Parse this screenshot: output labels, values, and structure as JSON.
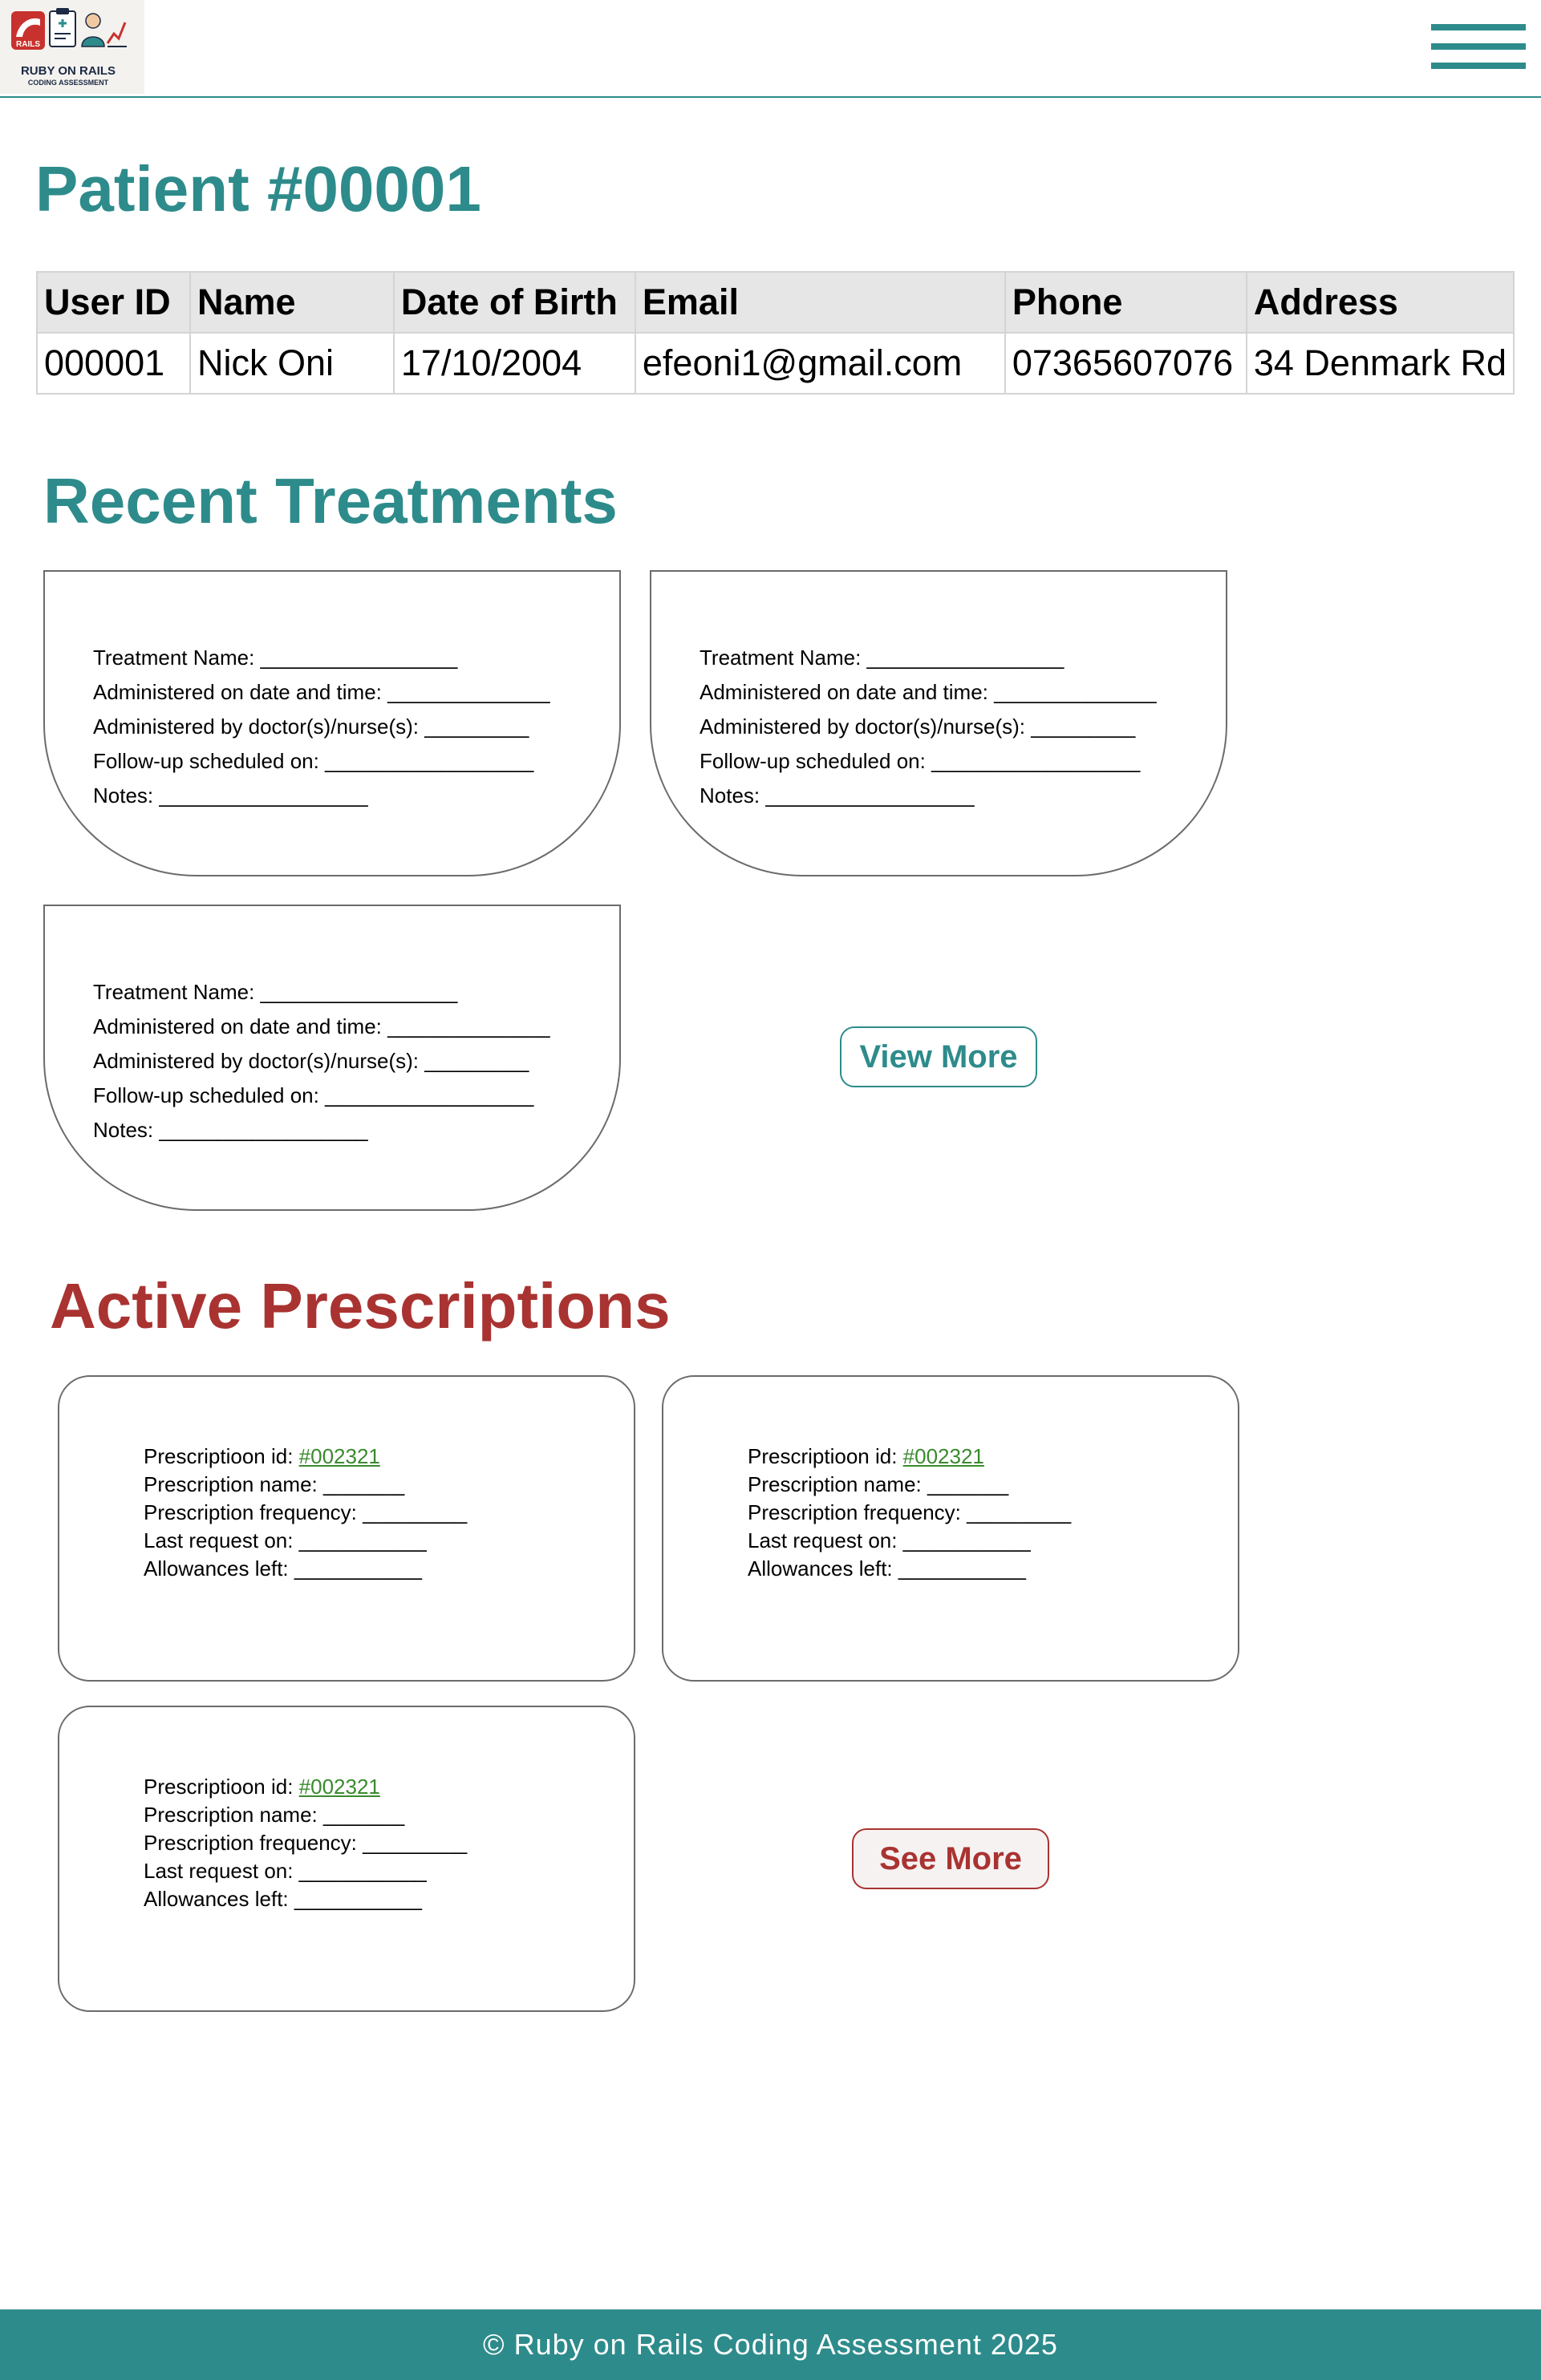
{
  "header": {
    "logo": {
      "badge": "RAILS",
      "title": "RUBY ON RAILS",
      "subtitle": "CODING ASSESSMENT"
    },
    "menu_icon": "hamburger-icon"
  },
  "patient": {
    "title": "Patient #00001",
    "columns": [
      "User ID",
      "Name",
      "Date of Birth",
      "Email",
      "Phone",
      "Address"
    ],
    "row": [
      "000001",
      "Nick Oni",
      "17/10/2004",
      "efeoni1@gmail.com",
      "07365607076",
      "34 Denmark Rd"
    ]
  },
  "treatments": {
    "title": "Recent Treatments",
    "cards": [
      {
        "lines": [
          "Treatment Name: _________________",
          "Administered on date and time: ______________",
          "Administered by doctor(s)/nurse(s): _________",
          "Follow-up scheduled on: __________________",
          "Notes: __________________"
        ]
      },
      {
        "lines": [
          "Treatment Name: _________________",
          "Administered on date and time: ______________",
          "Administered by doctor(s)/nurse(s): _________",
          "Follow-up scheduled on: __________________",
          "Notes: __________________"
        ]
      },
      {
        "lines": [
          "Treatment Name: _________________",
          "Administered on date and time: ______________",
          "Administered by doctor(s)/nurse(s): _________",
          "Follow-up scheduled on: __________________",
          "Notes: __________________"
        ]
      }
    ],
    "view_more_label": "View More"
  },
  "prescriptions": {
    "title": "Active Prescriptions",
    "cards": [
      {
        "id_label": "Prescriptioon id: ",
        "id_link": "#002321",
        "lines": [
          "Prescription name: _______",
          "Prescription frequency: _________",
          "Last request on: ___________",
          "Allowances left: ___________"
        ]
      },
      {
        "id_label": "Prescriptioon id: ",
        "id_link": "#002321",
        "lines": [
          "Prescription name: _______",
          "Prescription frequency: _________",
          "Last request on: ___________",
          "Allowances left: ___________"
        ]
      },
      {
        "id_label": "Prescriptioon id: ",
        "id_link": "#002321",
        "lines": [
          "Prescription name: _______",
          "Prescription frequency: _________",
          "Last request on: ___________",
          "Allowances left: ___________"
        ]
      }
    ],
    "see_more_label": "See More"
  },
  "footer": {
    "text": "© Ruby on Rails Coding Assessment 2025"
  },
  "colors": {
    "teal": "#2e8b8b",
    "red": "#a93331",
    "link_green": "#3a8a2e"
  }
}
